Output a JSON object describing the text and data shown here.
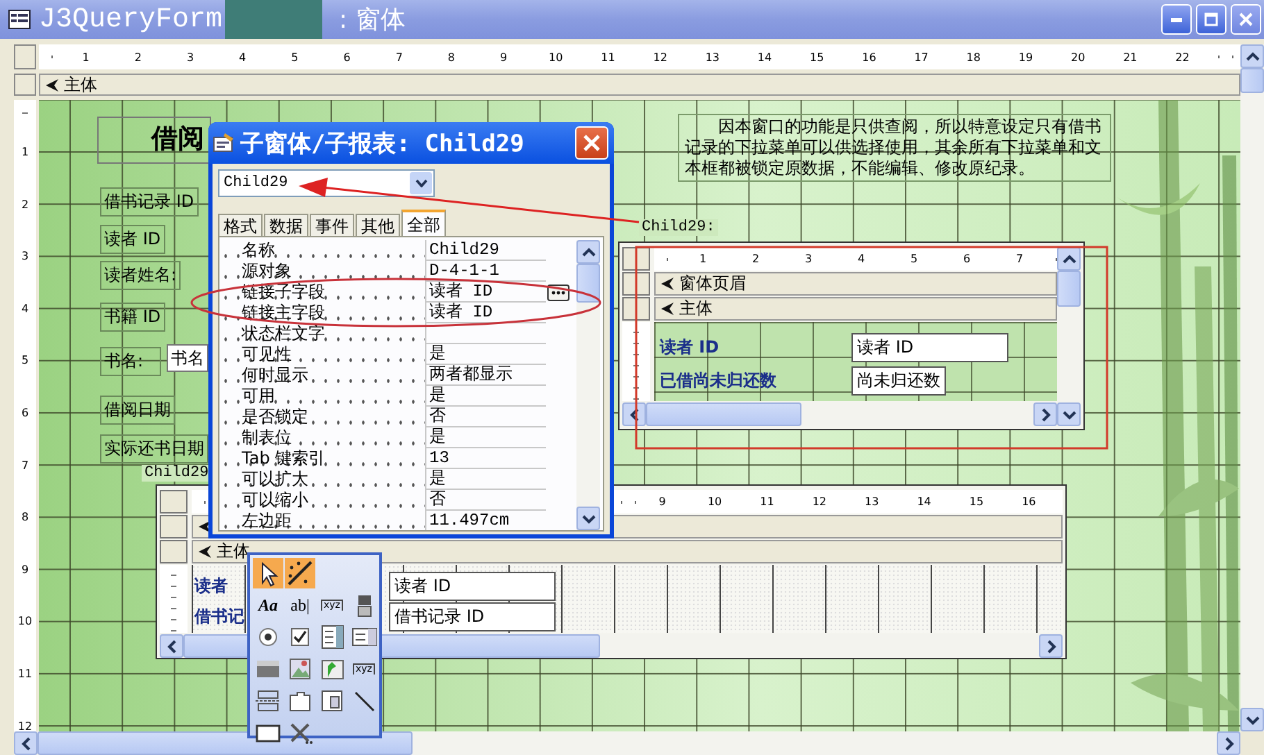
{
  "window": {
    "title": "J3QueryForm",
    "title_suffix": ": 窗体"
  },
  "ruler": {
    "marks": [
      "1",
      "2",
      "3",
      "4",
      "5",
      "6",
      "7",
      "8",
      "9",
      "10",
      "11",
      "12",
      "13",
      "14",
      "15",
      "16",
      "17",
      "18",
      "19",
      "20",
      "21",
      "22"
    ]
  },
  "vertical_ruler": {
    "marks": [
      "1",
      "2",
      "3",
      "4",
      "5",
      "6",
      "7",
      "8",
      "9",
      "10",
      "11",
      "12"
    ]
  },
  "section": {
    "label": "主体"
  },
  "form_title": "借阅",
  "labels": [
    {
      "text": "借书记录 ID"
    },
    {
      "text": "读者 ID"
    },
    {
      "text": "读者姓名:"
    },
    {
      "text": "书籍 ID"
    },
    {
      "text": "书名:"
    },
    {
      "text": "借阅日期"
    },
    {
      "text": "实际还书日期"
    }
  ],
  "book_field": {
    "value": "书名"
  },
  "note": "因本窗口的功能是只供查阅，所以特意设定只有借书记录的下拉菜单可以供选择使用，其余所有下拉菜单和文本框都被锁定原数据，不能编辑、修改原纪录。",
  "subform_right": {
    "caption": "Child29:",
    "ruler": [
      "1",
      "2",
      "3",
      "4",
      "5",
      "6",
      "7"
    ],
    "sections": [
      "窗体页眉",
      "主体"
    ],
    "rows": [
      {
        "label": "读者 ID",
        "value": "读者 ID"
      },
      {
        "label": "已借尚未归还数",
        "value": "尚未归还数"
      }
    ]
  },
  "subform_bottom": {
    "caption": "Child29",
    "ruler": [
      "9",
      "10",
      "11",
      "12",
      "13",
      "14",
      "15",
      "16"
    ],
    "section": "主体",
    "rows": [
      {
        "label": "读者",
        "value": "读者 ID"
      },
      {
        "label": "借书记",
        "value": "借书记录 ID"
      }
    ]
  },
  "dialog": {
    "title": "子窗体/子报表: Child29",
    "object": "Child29",
    "tabs": [
      {
        "label": "格式",
        "selected": false
      },
      {
        "label": "数据",
        "selected": false
      },
      {
        "label": "事件",
        "selected": false
      },
      {
        "label": "其他",
        "selected": false
      },
      {
        "label": "全部",
        "selected": true
      }
    ],
    "properties": [
      {
        "name": "名称",
        "value": "Child29",
        "builder": false
      },
      {
        "name": "源对象",
        "value": "D-4-1-1",
        "builder": false
      },
      {
        "name": "链接子字段",
        "value": "读者 ID",
        "builder": true
      },
      {
        "name": "链接主字段",
        "value": "读者 ID",
        "builder": false
      },
      {
        "name": "状态栏文字",
        "builder": false
      },
      {
        "name": "可见性",
        "value": "是",
        "builder": false
      },
      {
        "name": "何时显示",
        "value": "两者都显示",
        "builder": false
      },
      {
        "name": "可用",
        "value": "是",
        "builder": false
      },
      {
        "name": "是否锁定",
        "value": "否",
        "builder": false
      },
      {
        "name": "制表位",
        "value": "是",
        "builder": false
      },
      {
        "name": "Tab 键索引",
        "value": "13",
        "builder": false
      },
      {
        "name": "可以扩大",
        "value": "是",
        "builder": false
      },
      {
        "name": "可以缩小",
        "value": "否",
        "builder": false
      },
      {
        "name": "左边距",
        "value": "11.497cm",
        "builder": false
      }
    ]
  },
  "toolbox": {
    "tools": [
      {
        "kind": "pointer",
        "selected": true
      },
      {
        "kind": "wizard",
        "selected": true
      },
      {
        "kind": "label",
        "glyph": "Aa",
        "selected": false
      },
      {
        "kind": "textbox",
        "glyph": "ab|",
        "selected": false
      },
      {
        "kind": "group",
        "glyph": "xyz",
        "selected": false
      },
      {
        "kind": "toggle",
        "selected": false
      },
      {
        "kind": "radio",
        "selected": false
      },
      {
        "kind": "checkbox",
        "selected": false
      },
      {
        "kind": "combo",
        "selected": false
      },
      {
        "kind": "list",
        "selected": false
      },
      {
        "kind": "command",
        "selected": false
      },
      {
        "kind": "image",
        "selected": false
      },
      {
        "kind": "frame",
        "selected": false
      },
      {
        "kind": "bound",
        "glyph": "xyz",
        "selected": false
      },
      {
        "kind": "pagebreak",
        "selected": false
      },
      {
        "kind": "tab",
        "selected": false
      },
      {
        "kind": "subform",
        "selected": false
      },
      {
        "kind": "line",
        "selected": false
      },
      {
        "kind": "rect",
        "selected": false
      },
      {
        "kind": "tools",
        "selected": false
      }
    ]
  }
}
